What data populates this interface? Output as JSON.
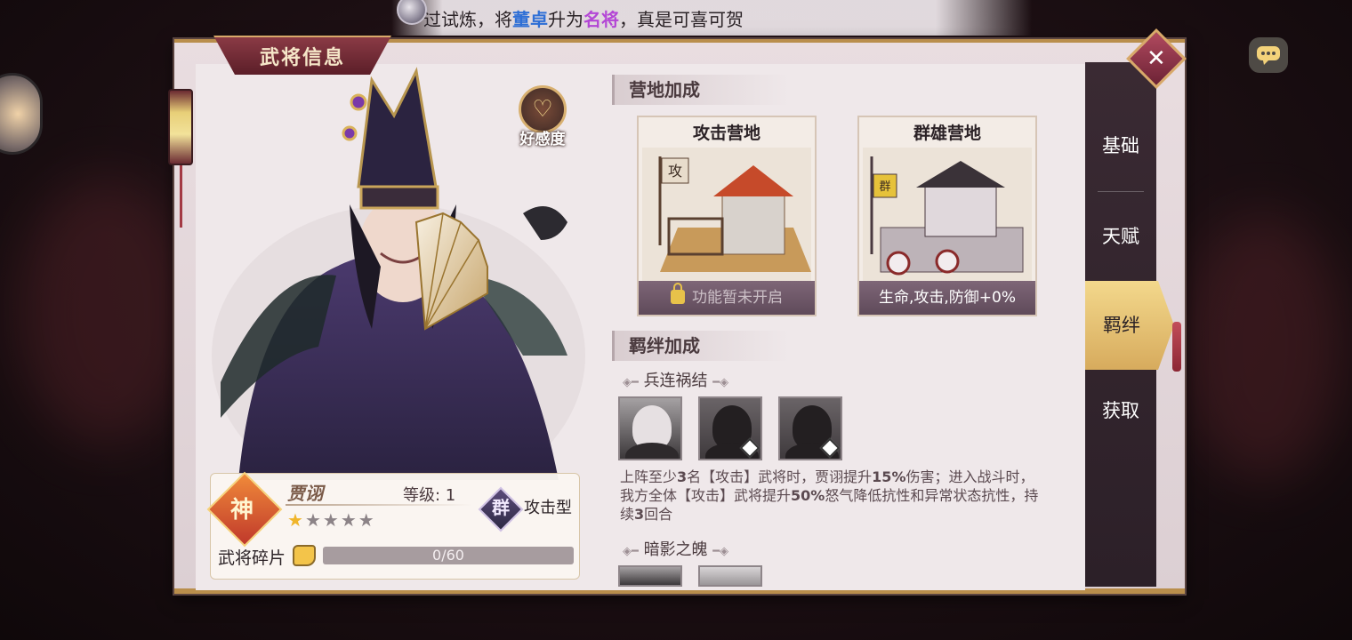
{
  "broadcast": {
    "prefix": "过试炼，将",
    "hero": "董卓",
    "middle": "升为",
    "rank": "名将",
    "suffix": "，真是可喜可贺"
  },
  "panel": {
    "title": "武将信息",
    "close_icon": "close-icon"
  },
  "affinity": {
    "label": "好感度",
    "icon": "heart-icon"
  },
  "hero": {
    "badge": "神",
    "name": "贾诩",
    "level_label": "等级: 1",
    "stars_total": 5,
    "stars_filled": 1,
    "faction": "群",
    "type": "攻击型",
    "shard_label": "武将碎片",
    "shard_progress": "0/60"
  },
  "camp": {
    "section_title": "营地加成",
    "cards": [
      {
        "title": "攻击营地",
        "footer": "功能暂未开启",
        "locked": true,
        "banner": "攻"
      },
      {
        "title": "群雄营地",
        "footer": "生命,攻击,防御+0%",
        "locked": false,
        "banner": "群"
      }
    ]
  },
  "bonds": {
    "section_title": "羁绊加成",
    "items": [
      {
        "title": "兵连祸结",
        "description_parts": [
          "上阵至少",
          "3",
          "名【攻击】武将时，贾诩提升",
          "15%",
          "伤害；进入战斗时，我方全体【攻击】武将提升",
          "50%",
          "怒气降低抗性和异常状态抗性，持续",
          "3",
          "回合"
        ]
      },
      {
        "title": "暗影之魄"
      }
    ]
  },
  "side_tabs": [
    {
      "label": "基础",
      "active": false
    },
    {
      "label": "天赋",
      "active": false
    },
    {
      "label": "羁绊",
      "active": true
    },
    {
      "label": "获取",
      "active": false
    }
  ],
  "colors": {
    "accent_gold": "#d7ab5d",
    "title_red": "#5b1e28",
    "highlight_blue": "#2f6fd6",
    "highlight_purple": "#b447d6",
    "star_gold": "#f0b52a"
  }
}
